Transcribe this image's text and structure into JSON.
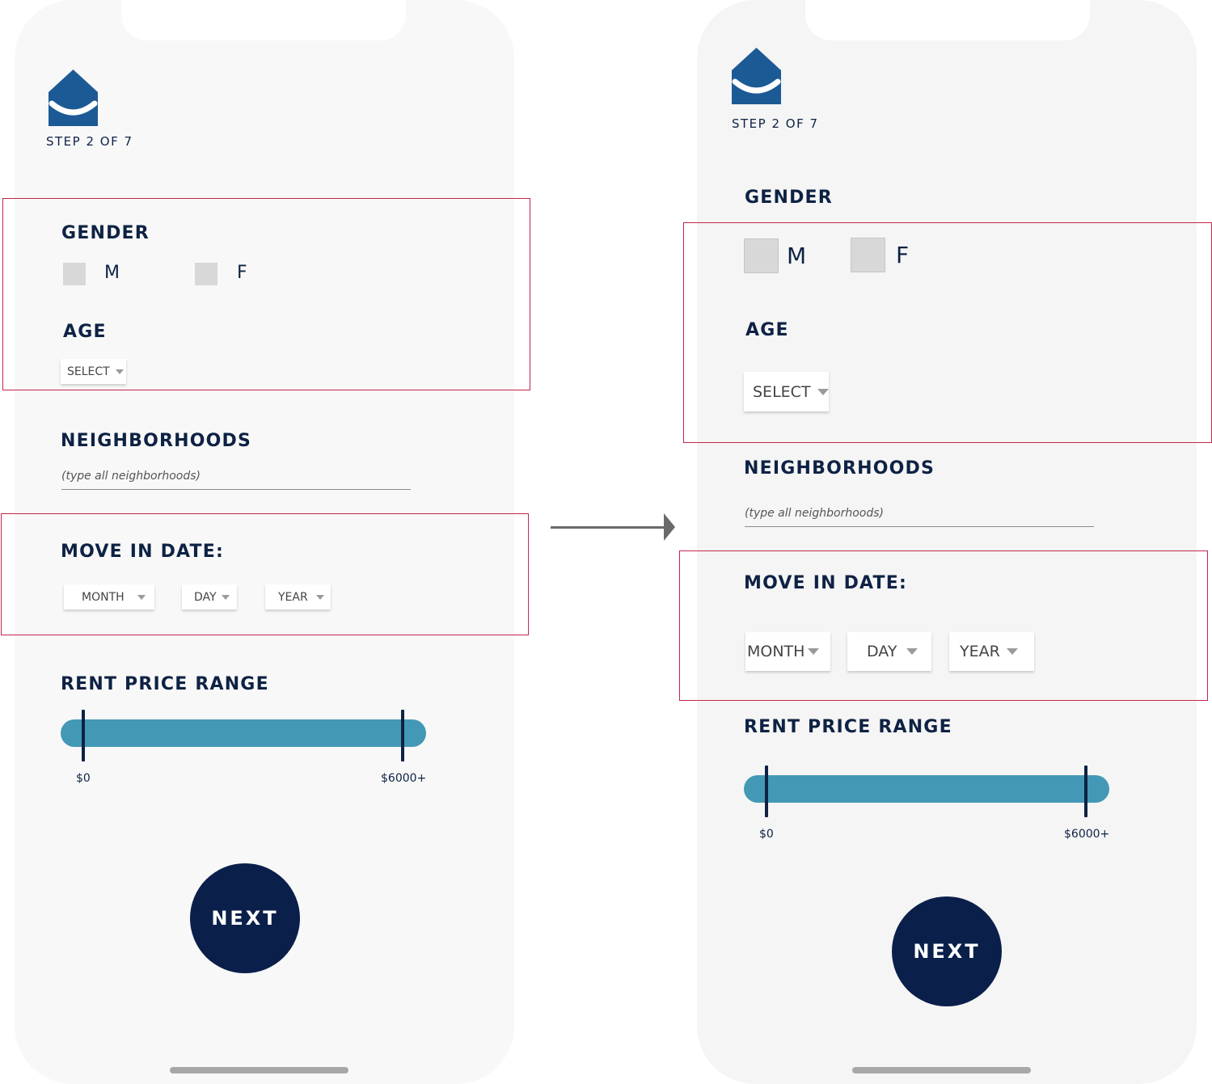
{
  "screens": {
    "before": {
      "step": "STEP 2 OF 7",
      "gender": {
        "title": "GENDER",
        "option_m": "M",
        "option_f": "F"
      },
      "age": {
        "title": "AGE",
        "select_label": "SELECT"
      },
      "neighborhoods": {
        "title": "NEIGHBORHOODS",
        "placeholder": "(type all neighborhoods)"
      },
      "move_in": {
        "title": "MOVE IN DATE:",
        "month": "MONTH",
        "day": "DAY",
        "year": "YEAR"
      },
      "rent": {
        "title": "RENT PRICE RANGE",
        "min_label": "$0",
        "max_label": "$6000+",
        "min_value": 0,
        "max_value": 6000
      },
      "next_label": "NEXT"
    },
    "after": {
      "step": "STEP 2 OF 7",
      "gender": {
        "title": "GENDER",
        "option_m": "M",
        "option_f": "F"
      },
      "age": {
        "title": "AGE",
        "select_label": "SELECT"
      },
      "neighborhoods": {
        "title": "NEIGHBORHOODS",
        "placeholder": "(type all neighborhoods)"
      },
      "move_in": {
        "title": "MOVE IN DATE:",
        "month": "MONTH",
        "day": "DAY",
        "year": "YEAR"
      },
      "rent": {
        "title": "RENT PRICE RANGE",
        "min_label": "$0",
        "max_label": "$6000+",
        "min_value": 0,
        "max_value": 6000
      },
      "next_label": "NEXT"
    }
  },
  "icons": {
    "logo": "house-smile-icon",
    "dropdown": "caret-down-icon",
    "arrow": "arrow-right-icon"
  },
  "colors": {
    "brand_blue": "#1c5a96",
    "navy": "#0b1f4b",
    "track_teal": "#4398b5",
    "highlight_red": "#c1264a",
    "checkbox_gray": "#d8d8d8"
  }
}
